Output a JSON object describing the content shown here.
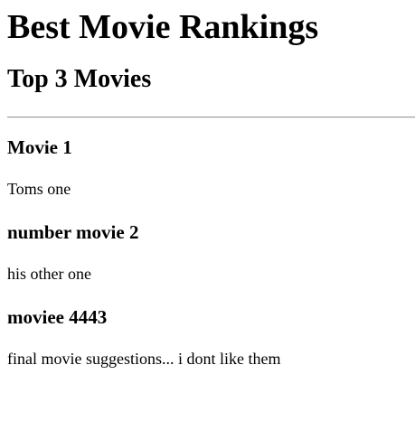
{
  "header": {
    "title": "Best Movie Rankings",
    "subtitle": "Top 3 Movies"
  },
  "movies": [
    {
      "title": "Movie 1",
      "description": "Toms one"
    },
    {
      "title": "number movie 2",
      "description": "his other one"
    },
    {
      "title": "moviee 4443",
      "description": "final movie suggestions... i dont like them"
    }
  ]
}
